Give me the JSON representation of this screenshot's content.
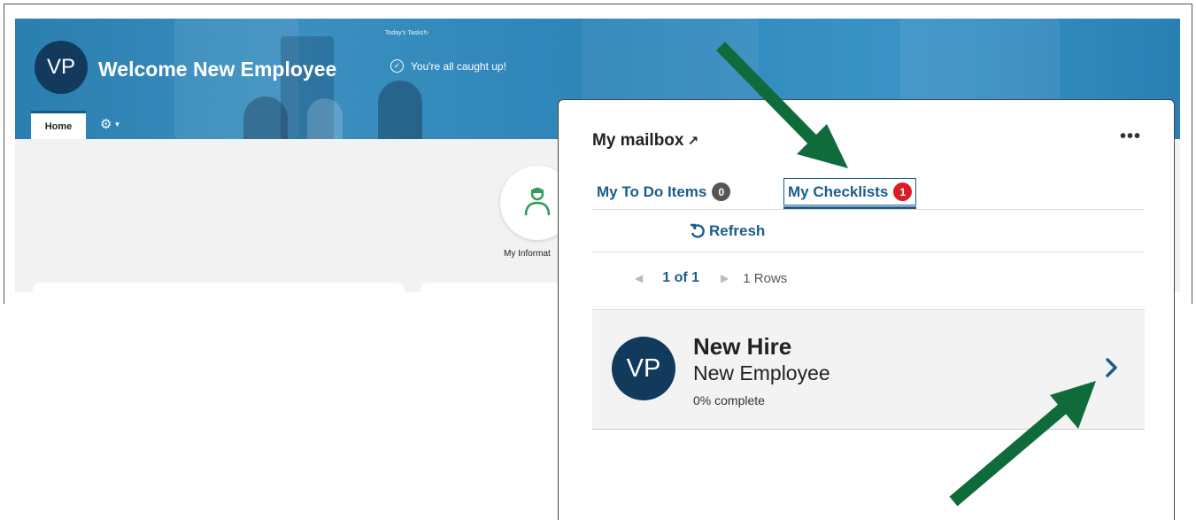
{
  "banner": {
    "top_tasks": "Today's Tasks",
    "avatar_initials": "VP",
    "welcome": "Welcome New Employee",
    "caught_up": "You're all caught up!",
    "home_tab": "Home",
    "check_icon": "✓"
  },
  "content": {
    "my_info_label": "My Informat"
  },
  "mailbox": {
    "title": "My mailbox",
    "title_icon": "↗",
    "more_icon": "•••",
    "tabs": [
      {
        "label": "My To Do Items",
        "count": "0"
      },
      {
        "label": "My Checklists",
        "count": "1"
      }
    ],
    "refresh_label": "Refresh",
    "pager": {
      "pages": "1 of 1",
      "rows": "1 Rows"
    },
    "item": {
      "avatar_initials": "VP",
      "title": "New Hire",
      "subtitle": "New Employee",
      "progress": "0% complete"
    }
  },
  "colors": {
    "accent": "#1b5d8c",
    "badge_red": "#d81e2a",
    "arrow_green": "#0f6b3a",
    "avatar_navy": "#123a5c"
  }
}
